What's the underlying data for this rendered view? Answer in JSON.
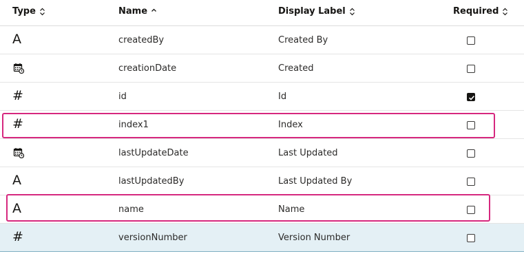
{
  "header": {
    "type": "Type",
    "name": "Name",
    "display_label": "Display Label",
    "required": "Required"
  },
  "rows": [
    {
      "type_icon": "text-type-icon",
      "type_glyph": "A",
      "name": "createdBy",
      "label": "Created By",
      "required": false
    },
    {
      "type_icon": "datetime-type-icon",
      "type_glyph": "",
      "name": "creationDate",
      "label": "Created",
      "required": false
    },
    {
      "type_icon": "number-type-icon",
      "type_glyph": "#",
      "name": "id",
      "label": "Id",
      "required": true
    },
    {
      "type_icon": "number-type-icon",
      "type_glyph": "#",
      "name": "index1",
      "label": "Index",
      "required": false
    },
    {
      "type_icon": "datetime-type-icon",
      "type_glyph": "",
      "name": "lastUpdateDate",
      "label": "Last Updated",
      "required": false
    },
    {
      "type_icon": "text-type-icon",
      "type_glyph": "A",
      "name": "lastUpdatedBy",
      "label": "Last Updated By",
      "required": false
    },
    {
      "type_icon": "text-type-icon",
      "type_glyph": "A",
      "name": "name",
      "label": "Name",
      "required": false
    },
    {
      "type_icon": "number-type-icon",
      "type_glyph": "#",
      "name": "versionNumber",
      "label": "Version Number",
      "required": false
    }
  ],
  "colors": {
    "highlight": "#d6277e",
    "selected_row": "#e4f0f5",
    "text": "#161513"
  }
}
